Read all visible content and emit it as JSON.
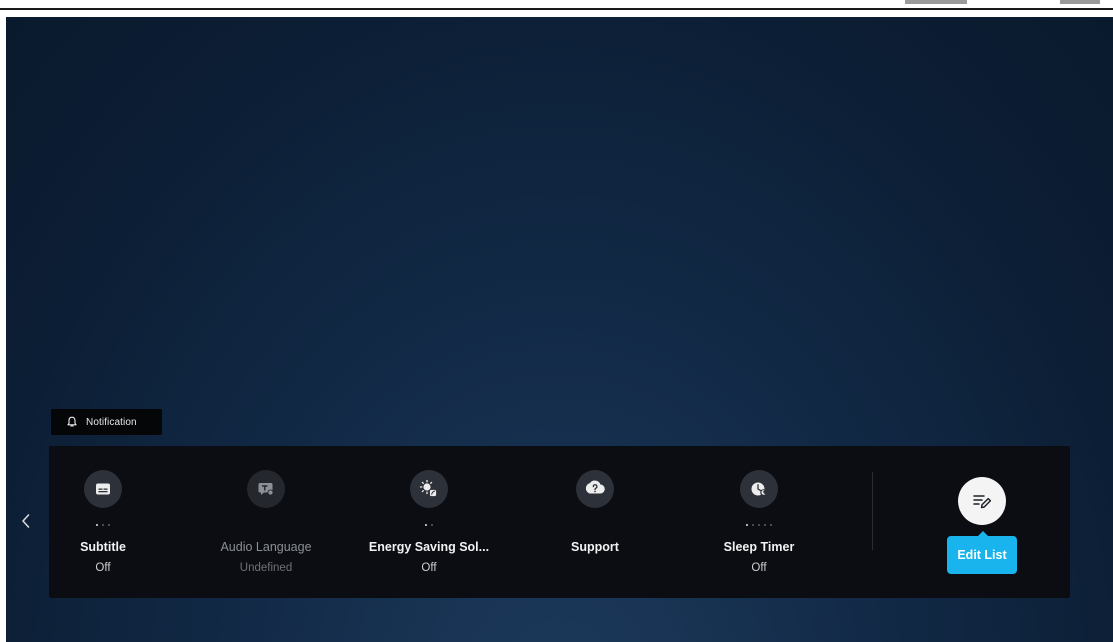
{
  "notification": {
    "label": "Notification",
    "icon": "bell-icon"
  },
  "nav": {
    "prev_icon": "chevron-left-icon"
  },
  "tiles": [
    {
      "name": "Subtitle",
      "value": "Off",
      "icon": "subtitle-icon",
      "enabled": true,
      "dots": 3,
      "active_dot": 1
    },
    {
      "name": "Audio Language",
      "value": "Undefined",
      "icon": "audio-language-icon",
      "enabled": false,
      "dots": 0,
      "active_dot": 0
    },
    {
      "name": "Energy Saving Sol...",
      "value": "Off",
      "icon": "energy-saving-icon",
      "enabled": true,
      "dots": 2,
      "active_dot": 1
    },
    {
      "name": "Support",
      "value": "",
      "icon": "support-icon",
      "enabled": true,
      "dots": 0,
      "active_dot": 0
    },
    {
      "name": "Sleep Timer",
      "value": "Off",
      "icon": "sleep-timer-icon",
      "enabled": true,
      "dots": 5,
      "active_dot": 1
    }
  ],
  "edit": {
    "label": "Edit List",
    "icon": "edit-list-icon"
  },
  "colors": {
    "accent": "#19b3ee",
    "panel": "#0b0d12",
    "background": "#0f243d"
  }
}
